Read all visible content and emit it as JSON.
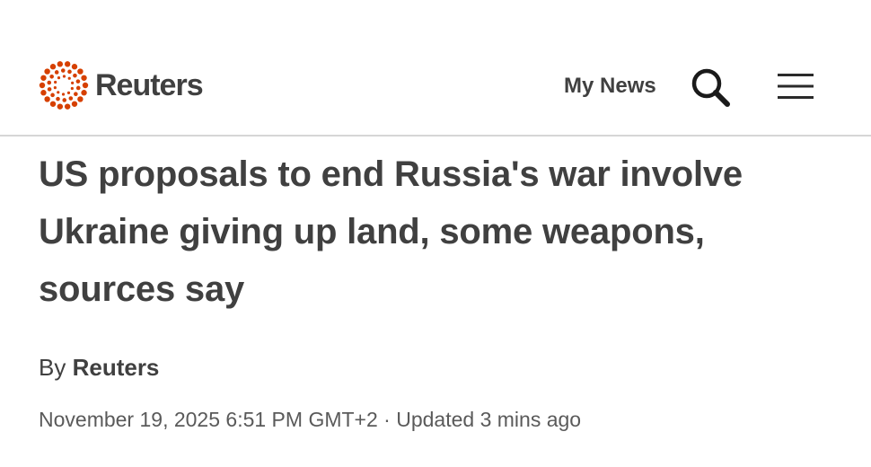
{
  "header": {
    "logo_text": "Reuters",
    "my_news_label": "My News",
    "search_icon": "search-icon",
    "menu_icon": "hamburger-menu-icon",
    "brand_color": "#d64000"
  },
  "article": {
    "headline": "US proposals to end Russia's war involve Ukraine giving up land, some weapons, sources say",
    "byline_prefix": "By",
    "author": "Reuters",
    "published": "November 19, 2025 6:51 PM GMT+2",
    "separator": "·",
    "updated": "Updated 3 mins ago"
  }
}
